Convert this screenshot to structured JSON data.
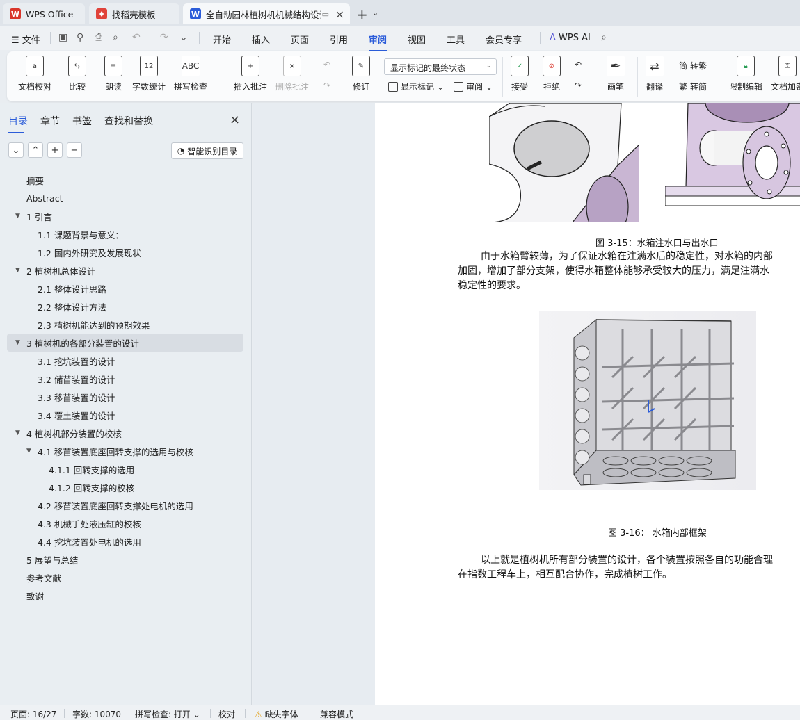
{
  "tabs": {
    "wps": "WPS Office",
    "template": "找稻壳模板",
    "document": "全自动园林植树机机械结构设计"
  },
  "menu": {
    "file": "文件",
    "items": [
      "开始",
      "插入",
      "页面",
      "引用",
      "审阅",
      "视图",
      "工具",
      "会员专享"
    ],
    "active": "审阅",
    "wps_ai": "WPS AI"
  },
  "ribbon": {
    "doc_check": "文档校对",
    "compare": "比较",
    "read_aloud": "朗读",
    "word_count": "字数统计",
    "spell_check": "拼写检查",
    "insert_comment": "插入批注",
    "delete_comment": "删除批注",
    "revise": "修订",
    "markup_select": "显示标记的最终状态",
    "show_markup": "显示标记",
    "review": "审阅",
    "accept": "接受",
    "reject": "拒绝",
    "pen": "画笔",
    "translate": "翻译",
    "to_traditional": "转繁",
    "to_simplified": "转简",
    "restrict_edit": "限制编辑",
    "doc_encrypt": "文档加密"
  },
  "left_panel": {
    "tabs": [
      "目录",
      "章节",
      "书签",
      "查找和替换"
    ],
    "smart_toc": "智能识别目录",
    "toc": [
      {
        "text": "摘要",
        "level": 0
      },
      {
        "text": "Abstract",
        "level": 0
      },
      {
        "text": "1  引言",
        "level": 0,
        "expanded": true
      },
      {
        "text": "1.1  课题背景与意义：",
        "level": 1
      },
      {
        "text": "1.2  国内外研究及发展现状",
        "level": 1
      },
      {
        "text": "2  植树机总体设计",
        "level": 0,
        "expanded": true
      },
      {
        "text": "2.1    整体设计思路",
        "level": 1
      },
      {
        "text": "2.2  整体设计方法",
        "level": 1
      },
      {
        "text": "2.3 植树机能达到的预期效果",
        "level": 1
      },
      {
        "text": "3    植树机的各部分装置的设计",
        "level": 0,
        "expanded": true,
        "selected": true
      },
      {
        "text": "3.1  挖坑装置的设计",
        "level": 1
      },
      {
        "text": "3.2  储苗装置的设计",
        "level": 1
      },
      {
        "text": "3.3    移苗装置的设计",
        "level": 1
      },
      {
        "text": "3.4    覆土装置的设计",
        "level": 1
      },
      {
        "text": "4    植树机部分装置的校核",
        "level": 0,
        "expanded": true
      },
      {
        "text": "4.1  移苗装置底座回转支撑的选用与校核",
        "level": 1,
        "expanded": true
      },
      {
        "text": "4.1.1  回转支撑的选用",
        "level": 2
      },
      {
        "text": "4.1.2 回转支撑的校核",
        "level": 2
      },
      {
        "text": "4.2 移苗装置底座回转支撑处电机的选用",
        "level": 1
      },
      {
        "text": "4.3  机械手处液压缸的校核",
        "level": 1
      },
      {
        "text": "4.4 挖坑装置处电机的选用",
        "level": 1
      },
      {
        "text": "5    展望与总结",
        "level": 0
      },
      {
        "text": "参考文献",
        "level": 0
      },
      {
        "text": "致谢",
        "level": 0
      }
    ]
  },
  "document": {
    "caption_1": "图 3-15：水箱注水口与出水口",
    "para_1": [
      "由于水箱臂较薄，为了保证水箱在注满水后的稳定性，对水箱的内部",
      "加固，增加了部分支架，使得水箱整体能够承受较大的压力，满足注满水",
      "稳定性的要求。"
    ],
    "caption_2": "图 3-16：  水箱内部框架",
    "para_2": [
      "以上就是植树机所有部分装置的设计，各个装置按照各自的功能合理",
      "在指数工程车上，相互配合协作，完成植树工作。"
    ]
  },
  "status": {
    "page": "页面: 16/27",
    "words": "字数: 10070",
    "spell": "拼写检查: 打开",
    "proof": "校对",
    "missing_font": "缺失字体",
    "compat": "兼容模式"
  },
  "colors": {
    "accent": "#2b5cd9",
    "wps_red": "#d9362b",
    "doc_blue": "#2b5cd9"
  }
}
